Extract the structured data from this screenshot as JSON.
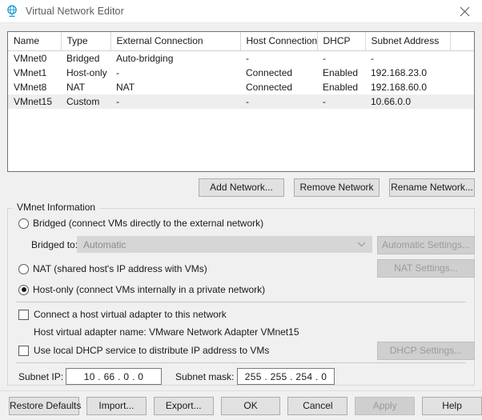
{
  "window": {
    "title": "Virtual Network Editor",
    "icon": "network-globe-icon",
    "close_label": "Close"
  },
  "network_table": {
    "columns": [
      "Name",
      "Type",
      "External Connection",
      "Host Connection",
      "DHCP",
      "Subnet Address",
      ""
    ],
    "rows": [
      {
        "name": "VMnet0",
        "type": "Bridged",
        "external_connection": "Auto-bridging",
        "host_connection": "-",
        "dhcp": "-",
        "subnet_address": "-",
        "selected": false
      },
      {
        "name": "VMnet1",
        "type": "Host-only",
        "external_connection": "-",
        "host_connection": "Connected",
        "dhcp": "Enabled",
        "subnet_address": "192.168.23.0",
        "selected": false
      },
      {
        "name": "VMnet8",
        "type": "NAT",
        "external_connection": "NAT",
        "host_connection": "Connected",
        "dhcp": "Enabled",
        "subnet_address": "192.168.60.0",
        "selected": false
      },
      {
        "name": "VMnet15",
        "type": "Custom",
        "external_connection": "-",
        "host_connection": "-",
        "dhcp": "-",
        "subnet_address": "10.66.0.0",
        "selected": true
      }
    ]
  },
  "table_buttons": {
    "add": "Add Network...",
    "remove": "Remove Network",
    "rename": "Rename Network..."
  },
  "vmnet_info": {
    "group_title": "VMnet Information",
    "bridged": {
      "label": "Bridged (connect VMs directly to the external network)",
      "selected": false,
      "bridged_to_label": "Bridged to:",
      "bridged_to_value": "Automatic",
      "bridged_to_enabled": false,
      "settings_button": "Automatic Settings...",
      "settings_enabled": false
    },
    "nat": {
      "label": "NAT (shared host's IP address with VMs)",
      "selected": false,
      "settings_button": "NAT Settings...",
      "settings_enabled": false
    },
    "host_only": {
      "label": "Host-only (connect VMs internally in a private network)",
      "selected": true
    },
    "connect_adapter": {
      "label": "Connect a host virtual adapter to this network",
      "checked": false
    },
    "adapter_name": "Host virtual adapter name: VMware Network Adapter VMnet15",
    "local_dhcp": {
      "label": "Use local DHCP service to distribute IP address to VMs",
      "checked": false,
      "settings_button": "DHCP Settings...",
      "settings_enabled": false
    },
    "subnet_ip_label": "Subnet IP:",
    "subnet_ip_value": "10 . 66 . 0  . 0",
    "subnet_mask_label": "Subnet mask:",
    "subnet_mask_value": "255 . 255 . 254 . 0"
  },
  "footer_buttons": {
    "restore_defaults": "Restore Defaults",
    "import": "Import...",
    "export": "Export...",
    "ok": "OK",
    "cancel": "Cancel",
    "apply": "Apply",
    "apply_enabled": false,
    "help": "Help"
  },
  "colors": {
    "accent": "#1e9fd4",
    "window_bg": "#f0f0f0",
    "selection": "#eeeeee"
  }
}
